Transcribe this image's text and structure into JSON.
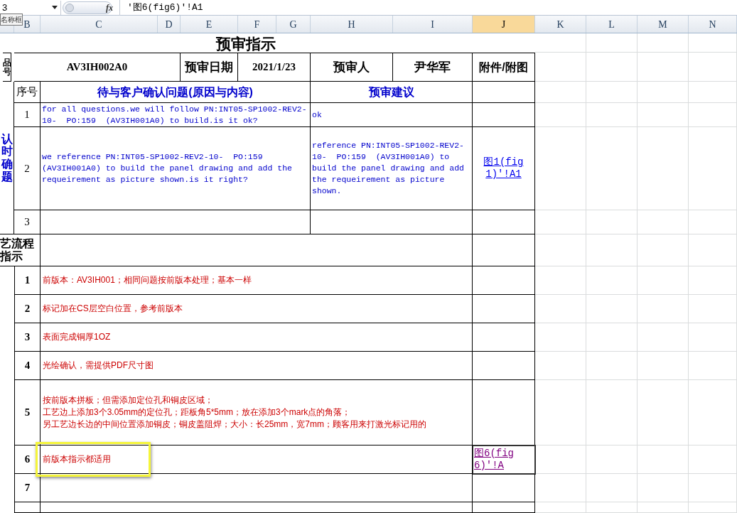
{
  "formula_bar": {
    "name_box": "3",
    "formula": "'图6(fig6)'!A1",
    "tooltip": "名称框",
    "function_label": "fx"
  },
  "column_headers": [
    {
      "label": "B",
      "selected": false
    },
    {
      "label": "C",
      "selected": false
    },
    {
      "label": "D",
      "selected": false
    },
    {
      "label": "E",
      "selected": false
    },
    {
      "label": "F",
      "selected": false
    },
    {
      "label": "G",
      "selected": false
    },
    {
      "label": "H",
      "selected": false
    },
    {
      "label": "I",
      "selected": false
    },
    {
      "label": "J",
      "selected": true
    },
    {
      "label": "K",
      "selected": false
    },
    {
      "label": "L",
      "selected": false
    },
    {
      "label": "M",
      "selected": false
    },
    {
      "label": "N",
      "selected": false
    }
  ],
  "title": "预审指示",
  "info_row": {
    "side_label": "品号",
    "part_number": "AV3IH002A0",
    "date_label": "预审日期",
    "date": "2021/1/23",
    "reviewer_label": "预审人",
    "reviewer": "尹华军",
    "attachment_label": "附件/附图"
  },
  "questions": {
    "side_label": "认时确题",
    "no_header": "序号",
    "question_header": "待与客户确认问题(原因与内容)",
    "suggestion_header": "预审建议",
    "rows": [
      {
        "no": "1",
        "question": "for all questions.we will follow PN:INT05-SP1002-REV2-10-  PO:159  (AV3IH001A0) to build.is it ok?",
        "suggestion": "ok"
      },
      {
        "no": "2",
        "question": "we reference PN:INT05-SP1002-REV2-10-  PO:159  (AV3IH001A0) to build the panel drawing and add the requeirement as picture shown.is it right?",
        "suggestion": "reference PN:INT05-SP1002-REV2-10-  PO:159  (AV3IH001A0) to build the panel drawing and add the requeirement as picture shown.",
        "attachment": {
          "text": "图1(fig1)'!A1",
          "visited": false,
          "selected": false
        }
      },
      {
        "no": "3"
      }
    ]
  },
  "process": {
    "side_label": [
      "艺流程",
      "指示"
    ],
    "rows": [
      {
        "no": "1",
        "lines": [
          "前版本：AV3IH001；相同问题按前版本处理；基本一样"
        ],
        "highlighted": false
      },
      {
        "no": "2",
        "lines": [
          "标记加在CS层空白位置，参考前版本"
        ],
        "highlighted": false
      },
      {
        "no": "3",
        "lines": [
          "表面完成铜厚1OZ"
        ],
        "highlighted": false
      },
      {
        "no": "4",
        "lines": [
          "光绘确认，需提供PDF尺寸图"
        ],
        "highlighted": false
      },
      {
        "no": "5",
        "lines": [
          "按前版本拼板；但需添加定位孔和铜皮区域；",
          "工艺边上添加3个3.05mm的定位孔；距板角5*5mm；放在添加3个mark点的角落；",
          "另工艺边长边的中间位置添加铜皮；铜皮盖阻焊；大小：长25mm，宽7mm；顾客用来打激光标记用的"
        ],
        "highlighted": false
      },
      {
        "no": "6",
        "lines": [
          "前版本指示都适用"
        ],
        "highlighted": true,
        "attachment": {
          "text": "图6(fig6)'!A",
          "visited": true,
          "selected": true
        }
      },
      {
        "no": "7",
        "highlighted": false
      }
    ]
  }
}
